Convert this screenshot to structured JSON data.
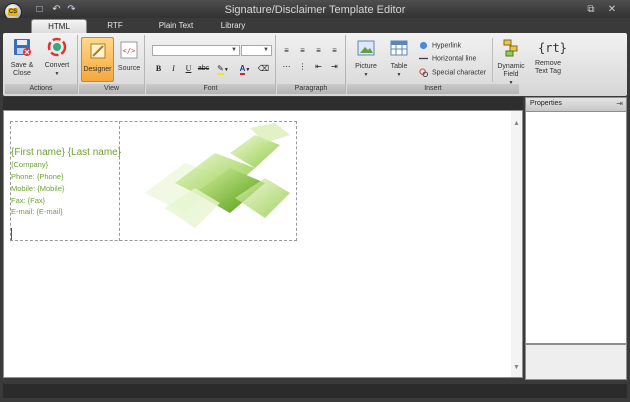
{
  "window": {
    "title": "Signature/Disclaimer Template Editor",
    "app_icon_text": "CS"
  },
  "tabs": [
    {
      "label": "HTML",
      "active": true
    },
    {
      "label": "RTF"
    },
    {
      "label": "Plain Text"
    },
    {
      "label": "Library"
    }
  ],
  "ribbon": {
    "actions": {
      "label": "Actions",
      "save_close": "Save & Close",
      "convert": "Convert"
    },
    "view": {
      "label": "View",
      "designer": "Designer",
      "source": "Source"
    },
    "font": {
      "label": "Font",
      "font_name": "",
      "font_size": ""
    },
    "paragraph": {
      "label": "Paragraph"
    },
    "insert": {
      "label": "Insert",
      "picture": "Picture",
      "table": "Table",
      "hyperlink": "Hyperlink",
      "horizontal_line": "Horizontal line",
      "special_character": "Special character",
      "dynamic_field": "Dynamic Field",
      "remove_text_tag": "Remove Text Tag",
      "rt_glyph": "{rt}"
    }
  },
  "editor": {
    "signature": {
      "name": "{First name} {Last name}",
      "lines": [
        "{Company}",
        "Phone: {Phone}",
        "Mobile: {Mobile}",
        "Fax: {Fax}",
        "E-mail: {E-mail}"
      ]
    }
  },
  "properties": {
    "title": "Properties",
    "pin_icon": "pin-icon"
  },
  "colors": {
    "accent_green": "#6da333",
    "pressed_orange": "#f5a83a"
  }
}
